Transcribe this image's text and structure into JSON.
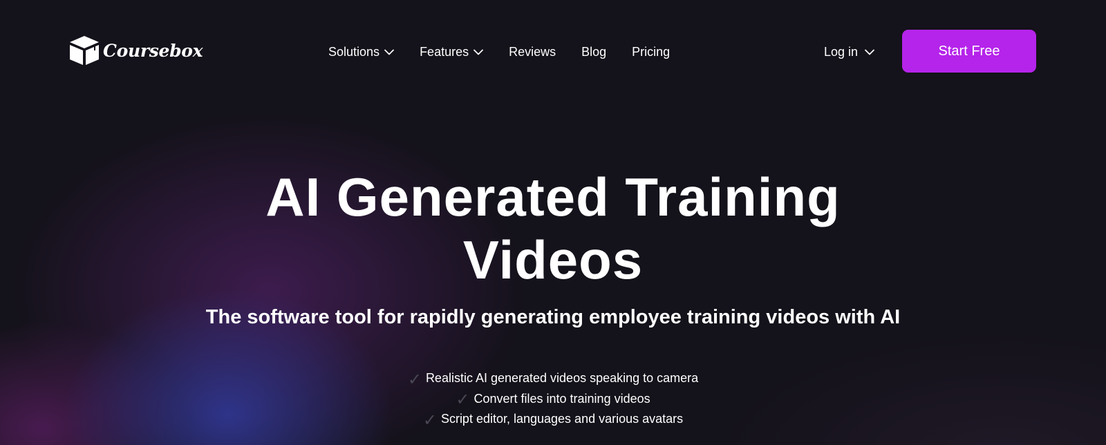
{
  "brand": {
    "name": "Coursebox"
  },
  "nav": {
    "items": [
      {
        "label": "Solutions",
        "dropdown": true
      },
      {
        "label": "Features",
        "dropdown": true
      },
      {
        "label": "Reviews",
        "dropdown": false
      },
      {
        "label": "Blog",
        "dropdown": false
      },
      {
        "label": "Pricing",
        "dropdown": false
      }
    ],
    "login_label": "Log in",
    "cta_label": "Start Free"
  },
  "hero": {
    "title_line1": "AI Generated Training",
    "title_line2": "Videos",
    "subtitle": "The software tool for rapidly generating employee training videos with AI",
    "features": [
      "Realistic AI generated videos speaking to camera",
      "Convert files into training videos",
      "Script editor, languages and various avatars"
    ],
    "check_glyph": "✓"
  },
  "colors": {
    "background": "#14121a",
    "accent": "#b524ea",
    "check": "#4a4754"
  },
  "icons": {
    "logo": "box-icon",
    "dropdown": "chevron-down-icon",
    "feature": "check-icon"
  }
}
